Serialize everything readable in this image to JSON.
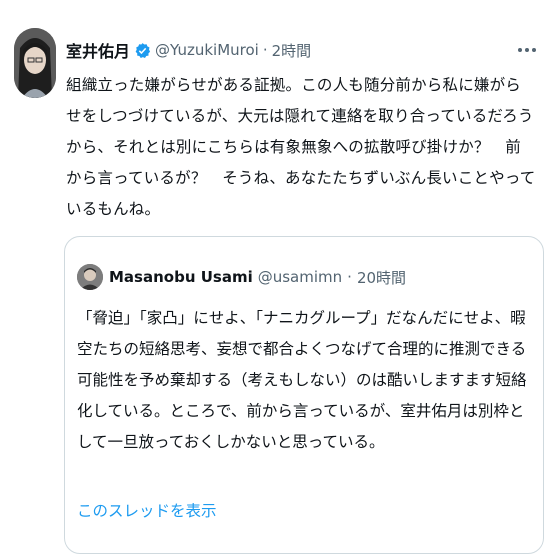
{
  "tweet": {
    "author_name": "室井佑月",
    "author_handle": "@YuzukiMuroi",
    "time": "2時間",
    "text": "組織立った嫌がらせがある証拠。この人も随分前から私に嫌がらせをしつづけているが、大元は隠れて連絡を取り合っているだろうから、それとは別にこちらは有象無象への拡散呼び掛けか？　前から言っているが？　そうね、あなたたちずいぶん長いことやっているもんね。"
  },
  "quote": {
    "author_name": "Masanobu Usami",
    "author_handle": "@usamimn",
    "time": "20時間",
    "text": "「脅迫」「家凸」にせよ、「ナニカグループ」だなんだにせよ、暇空たちの短絡思考、妄想で都合よくつなげて合理的に推測できる可能性を予め棄却する（考えもしない）のは酷いしますます短絡化している。ところで、前から言っているが、室井佑月は別枠として一旦放っておくしかないと思っている。",
    "thread_link": "このスレッドを表示"
  },
  "icons": [
    "verified-icon",
    "more-icon"
  ],
  "colors": {
    "link": "#1d9bf0",
    "secondary": "#536471",
    "border": "#cfd9de",
    "verified": "#1d9bf0"
  }
}
